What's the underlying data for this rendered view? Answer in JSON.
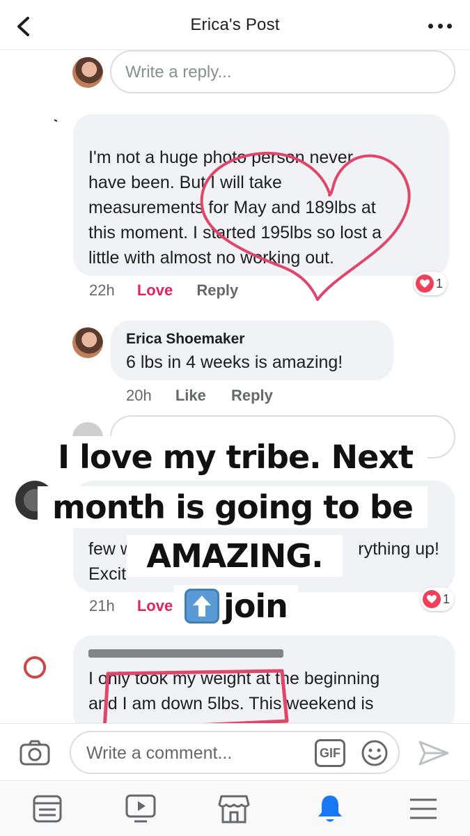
{
  "header": {
    "title": "Erica's Post"
  },
  "reply_box": {
    "placeholder": "Write a reply..."
  },
  "comments": [
    {
      "text_lines": [
        "I'm not a huge photo person never",
        "have been. But I will take",
        "measurements for May and 189lbs at",
        "this moment. I started 195lbs so lost a",
        "little with almost no working out."
      ],
      "time": "22h",
      "action1": "Love",
      "action2": "Reply",
      "reaction_count": "1"
    },
    {
      "author": "Erica Shoemaker",
      "text": "6 lbs in 4 weeks is amazing!",
      "time": "20h",
      "action1": "Like",
      "action2": "Reply"
    },
    {
      "text_lines": [
        "few w",
        "rything up!",
        "Excit"
      ],
      "time": "21h",
      "action1": "Love",
      "reaction_count": "1"
    },
    {
      "text_lines": [
        "I only took my weight at the beginning",
        "and I am down 5lbs. This weekend is"
      ]
    }
  ],
  "overlay": {
    "line1": "I love my tribe. Next",
    "line2": "month is going to be",
    "line3": "AMAZING.",
    "line4": "join"
  },
  "composer": {
    "placeholder": "Write a comment...",
    "gif_label": "GIF"
  },
  "colors": {
    "love": "#e0245e",
    "annotation": "#e0456a",
    "active_tab": "#1877f2"
  }
}
